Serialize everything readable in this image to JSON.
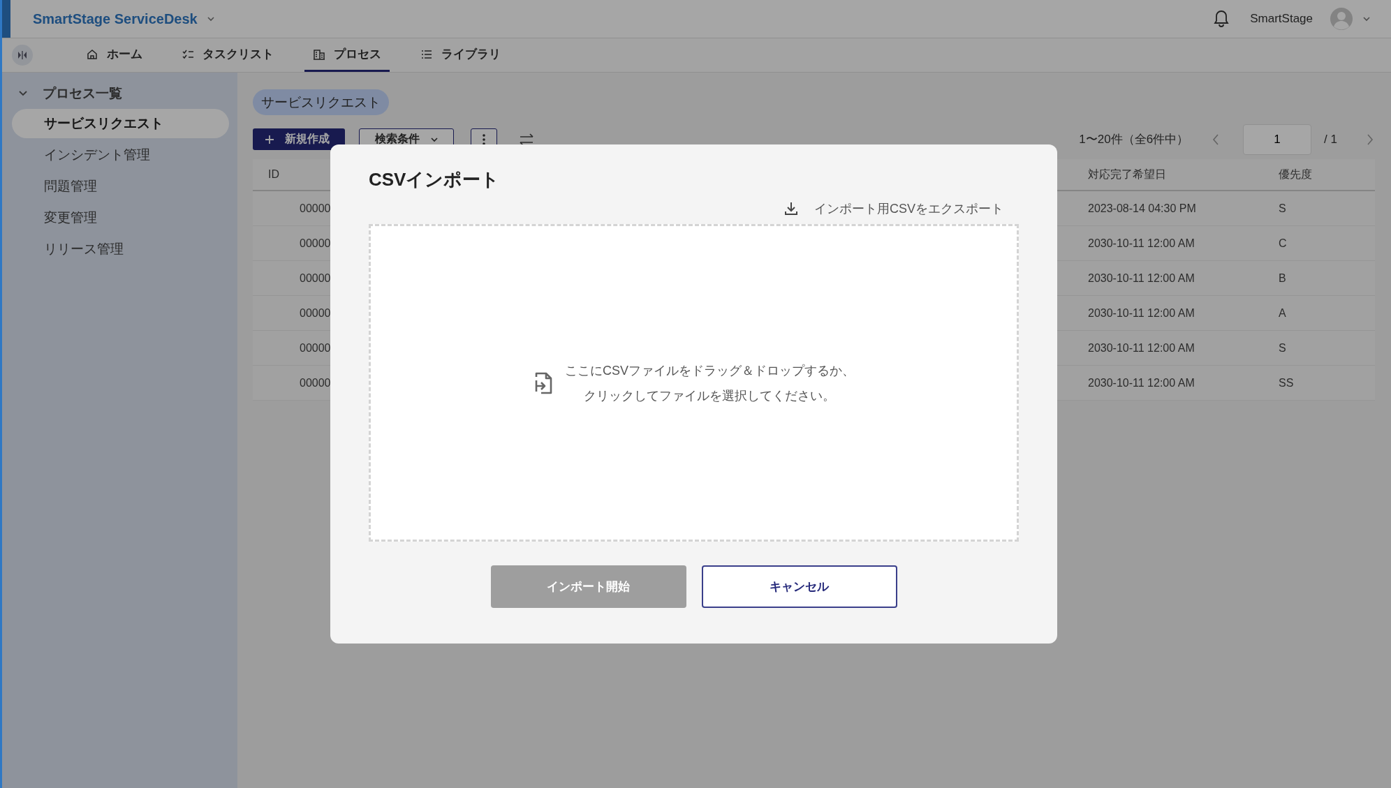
{
  "app": {
    "title": "SmartStage ServiceDesk",
    "user": "SmartStage"
  },
  "nav_tabs": [
    {
      "label": "ホーム",
      "selected": false
    },
    {
      "label": "タスクリスト",
      "selected": false
    },
    {
      "label": "プロセス",
      "selected": true
    },
    {
      "label": "ライブラリ",
      "selected": false
    }
  ],
  "sidebar": {
    "items": [
      {
        "label": "プロセス一覧",
        "expanded": true,
        "children": [
          {
            "label": "サービスリクエスト",
            "selected": true
          },
          {
            "label": "インシデント管理",
            "selected": false
          },
          {
            "label": "問題管理",
            "selected": false
          },
          {
            "label": "変更管理",
            "selected": false
          },
          {
            "label": "リリース管理",
            "selected": false
          }
        ]
      }
    ]
  },
  "breadcrumb": "サービスリクエスト",
  "toolbar": {
    "new_button": "新規作成",
    "filter_button": "検索条件"
  },
  "pagination": {
    "range": "1〜20件（全6件中）",
    "page": "1",
    "total": "/ 1"
  },
  "table": {
    "columns": [
      "ID",
      "対応完了希望日",
      "優先度"
    ],
    "rows": [
      [
        "00000",
        "2023-08-14 04:30 PM",
        "S"
      ],
      [
        "00000",
        "2030-10-11 12:00 AM",
        "C"
      ],
      [
        "00000",
        "2030-10-11 12:00 AM",
        "B"
      ],
      [
        "00000",
        "2030-10-11 12:00 AM",
        "A"
      ],
      [
        "00000",
        "2030-10-11 12:00 AM",
        "S"
      ],
      [
        "00000",
        "2030-10-11 12:00 AM",
        "SS"
      ]
    ]
  },
  "dialog": {
    "title": "CSVインポート",
    "export_link": "インポート用CSVをエクスポート",
    "drop_text": [
      "ここにCSVファイルをドラッグ＆ドロップするか、",
      "クリックしてファイルを選択してください。"
    ],
    "buttons": [
      {
        "label": "インポート開始",
        "kind": "primary",
        "disabled": true
      },
      {
        "label": "キャンセル",
        "kind": "secondary",
        "disabled": false
      }
    ]
  }
}
